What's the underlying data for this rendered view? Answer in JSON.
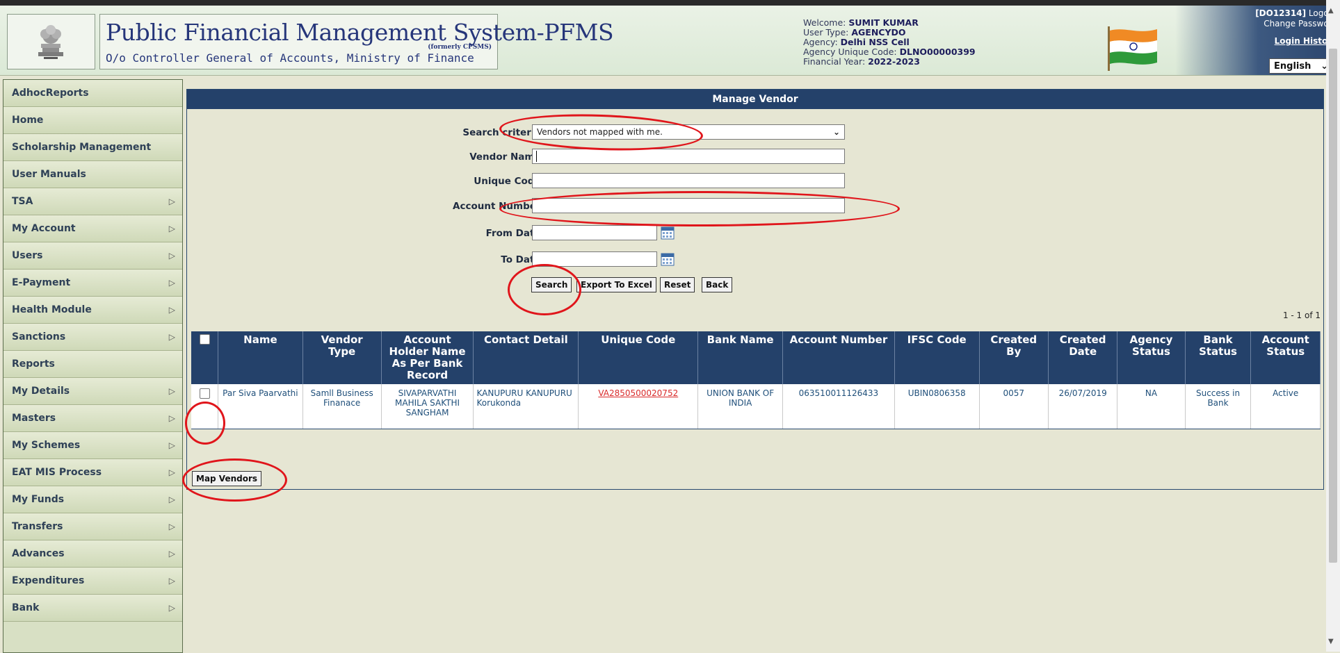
{
  "header": {
    "title": "Public Financial Management System-PFMS",
    "formerly": "(formerly CPSMS)",
    "subtitle": "O/o Controller General of Accounts, Ministry of Finance",
    "welcome_label": "Welcome:",
    "welcome_value": "SUMIT KUMAR",
    "usertype_label": "User Type:",
    "usertype_value": "AGENCYDO",
    "agency_label": "Agency:",
    "agency_value": "Delhi NSS Cell",
    "agency_code_label": "Agency Unique Code:",
    "agency_code_value": "DLNO00000399",
    "fy_label": "Financial Year:",
    "fy_value": "2022-2023",
    "user_code": "[DO12314]",
    "logout": "Logout",
    "change_password": "Change Password",
    "login_history": "Login History",
    "language": "English"
  },
  "sidebar": {
    "items": [
      {
        "label": "AdhocReports",
        "arrow": ""
      },
      {
        "label": "Home",
        "arrow": ""
      },
      {
        "label": "Scholarship Management",
        "arrow": ""
      },
      {
        "label": "User Manuals",
        "arrow": ""
      },
      {
        "label": "TSA",
        "arrow": "▷"
      },
      {
        "label": "My Account",
        "arrow": "▷"
      },
      {
        "label": "Users",
        "arrow": "▷"
      },
      {
        "label": "E-Payment",
        "arrow": "▷"
      },
      {
        "label": "Health Module",
        "arrow": "▷"
      },
      {
        "label": "Sanctions",
        "arrow": "▷"
      },
      {
        "label": "Reports",
        "arrow": ""
      },
      {
        "label": "My Details",
        "arrow": "▷"
      },
      {
        "label": "Masters",
        "arrow": "▷"
      },
      {
        "label": "My Schemes",
        "arrow": "▷"
      },
      {
        "label": "EAT MIS Process",
        "arrow": "▷"
      },
      {
        "label": "My Funds",
        "arrow": "▷"
      },
      {
        "label": "Transfers",
        "arrow": "▷"
      },
      {
        "label": "Advances",
        "arrow": "▷"
      },
      {
        "label": "Expenditures",
        "arrow": "▷"
      },
      {
        "label": "Bank",
        "arrow": "▷"
      }
    ]
  },
  "panel": {
    "title": "Manage Vendor",
    "search_criteria_label": "Search criteria:",
    "search_criteria_value": "Vendors not mapped with me.",
    "vendor_name_label": "Vendor Name:",
    "vendor_name_value": "",
    "unique_code_label": "Unique Code:",
    "unique_code_value": "",
    "account_number_label": "Account Number:",
    "account_number_value": "",
    "from_date_label": "From Date:",
    "from_date_value": "",
    "to_date_label": "To Date:",
    "to_date_value": "",
    "buttons": {
      "search": "Search",
      "export": "Export To Excel",
      "reset": "Reset",
      "back": "Back"
    },
    "pager": "1 - 1 of 1",
    "map_vendors": "Map Vendors"
  },
  "table": {
    "columns": [
      "Name",
      "Vendor Type",
      "Account Holder Name As Per Bank Record",
      "Contact Detail",
      "Unique Code",
      "Bank Name",
      "Account Number",
      "IFSC Code",
      "Created By",
      "Created Date",
      "Agency Status",
      "Bank Status",
      "Account Status"
    ],
    "rows": [
      {
        "name": "Par Siva Paarvathi",
        "vendor_type": "Samll Business Finanace",
        "holder": "SIVAPARVATHI MAHILA SAKTHI SANGHAM",
        "contact": "KANUPURU KANUPURU Korukonda",
        "unique_code": "VA2850500020752",
        "bank": "UNION BANK OF INDIA",
        "account": "063510011126433",
        "ifsc": "UBIN0806358",
        "created_by": "0057",
        "created_date": "26/07/2019",
        "agency_status": "NA",
        "bank_status": "Success in Bank",
        "account_status": "Active"
      }
    ]
  },
  "colors": {
    "header_blue": "#24416a",
    "annotation_red": "#e0151b",
    "link_red": "#d92a2a"
  }
}
